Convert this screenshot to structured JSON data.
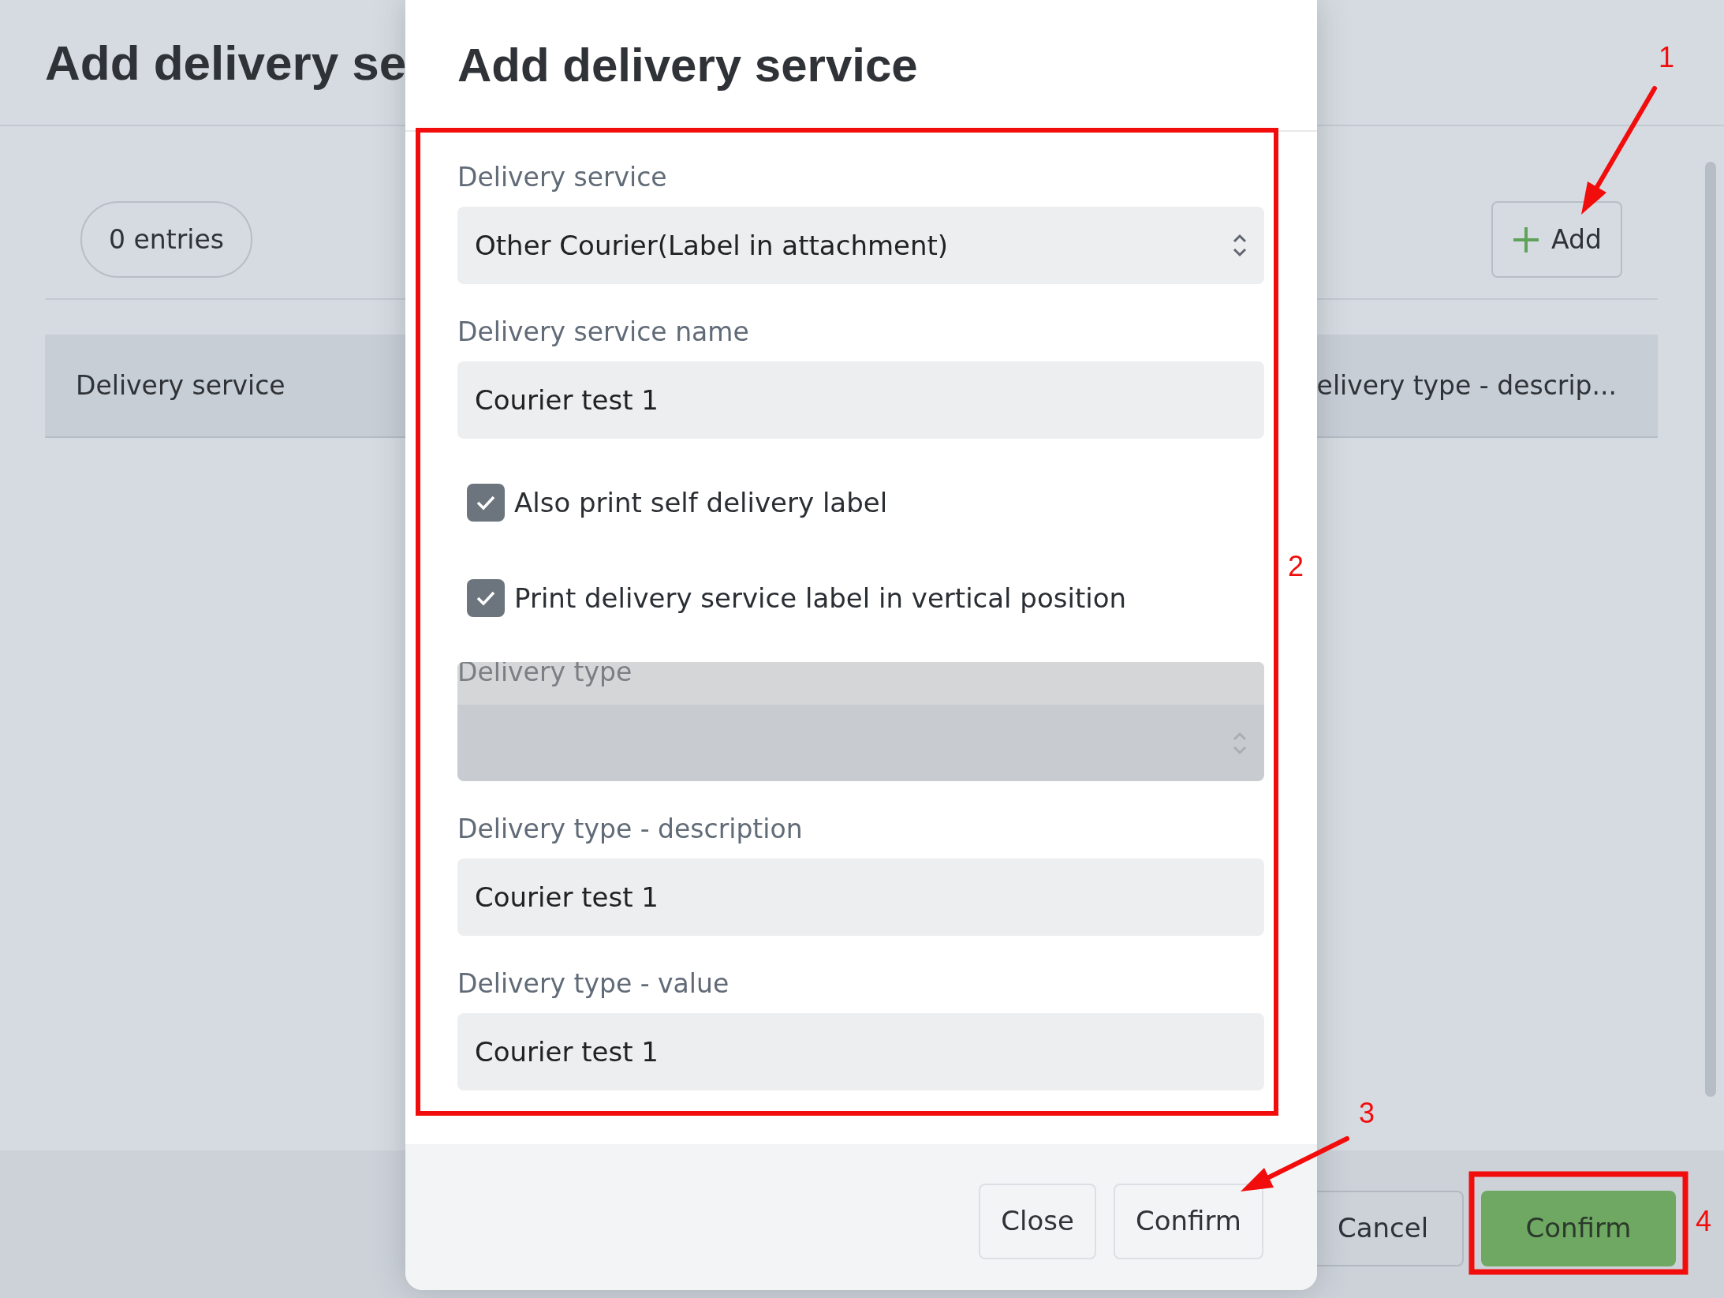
{
  "page": {
    "title": "Add delivery se",
    "entries": "0 entries",
    "add_button": "Add",
    "table": {
      "columns": [
        "Delivery service",
        "elivery type - descrip..."
      ]
    },
    "footer_buttons": [
      {
        "label": "Cancel",
        "kind": "secondary"
      },
      {
        "label": "Confirm",
        "kind": "primary"
      }
    ]
  },
  "dialog": {
    "title": "Add delivery service",
    "fields": [
      {
        "kind": "select",
        "label": "Delivery service",
        "value": "Other Courier(Label in attachment)",
        "disabled": false
      },
      {
        "kind": "text",
        "label": "Delivery service name",
        "value": "Courier test 1"
      },
      {
        "kind": "checkbox",
        "label": "Also print self delivery label",
        "checked": true
      },
      {
        "kind": "checkbox",
        "label": "Print delivery service label in vertical position",
        "checked": true
      },
      {
        "kind": "select",
        "label": "Delivery type",
        "disabled": true
      },
      {
        "kind": "text",
        "label": "Delivery type - description",
        "value": "Courier test 1"
      },
      {
        "kind": "text",
        "label": "Delivery type - value",
        "value": "Courier test 1"
      }
    ],
    "buttons": [
      "Close",
      "Confirm"
    ]
  },
  "annotations": [
    {
      "number": "1",
      "kind": "arrow"
    },
    {
      "number": "2",
      "kind": "frame"
    },
    {
      "number": "3",
      "kind": "arrow"
    },
    {
      "number": "4",
      "kind": "frame"
    }
  ]
}
